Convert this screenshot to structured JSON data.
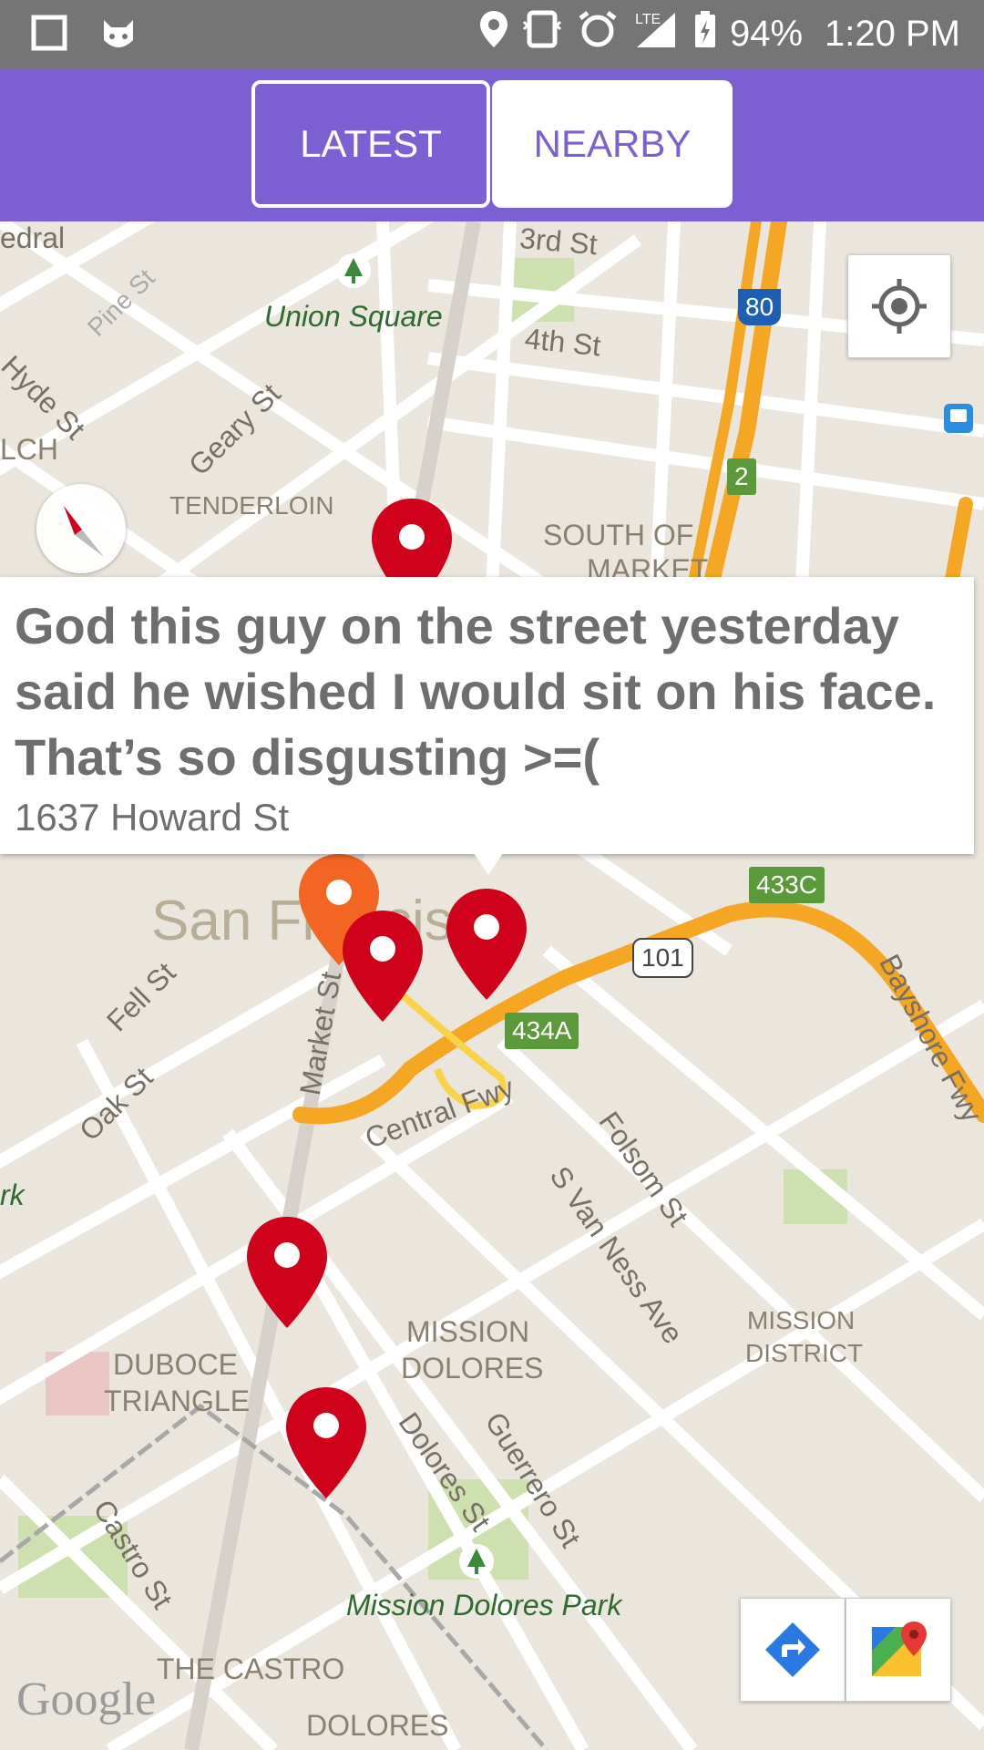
{
  "status_bar": {
    "battery": "94%",
    "time": "1:20 PM",
    "network": "LTE"
  },
  "tabs": {
    "latest": "LATEST",
    "nearby": "NEARBY"
  },
  "map": {
    "labels": {
      "cathedral": "edral",
      "union_square": "Union Square",
      "third_st": "3rd St",
      "fourth_st": "4th St",
      "pine_st": "Pine St",
      "hyde_st": "Hyde St",
      "geary_st": "Geary St",
      "lch": "LCH",
      "tenderloin": "TENDERLOIN",
      "south_of_market": "SOUTH OF",
      "south_of_market_2": "MARKET",
      "san_francisco": "San Francisco",
      "fell_st": "Fell St",
      "oak_st": "Oak St",
      "market_st": "Market St",
      "central_fwy": "Central Fwy",
      "folsom_st": "Folsom St",
      "s_van_ness": "S Van Ness Ave",
      "bayshore": "Bayshore Fwy",
      "mission_dolores": "MISSION",
      "mission_dolores_2": "DOLORES",
      "mission_district": "MISSION",
      "mission_district_2": "DISTRICT",
      "duboce": "DUBOCE",
      "duboce_2": "TRIANGLE",
      "dolores_st": "Dolores St",
      "guerrero_st": "Guerrero St",
      "castro_st": "Castro St",
      "mission_dolores_park": "Mission Dolores Park",
      "the_castro": "THE CASTRO",
      "dolores_bottom": "DOLORES",
      "rk": "rk",
      "google": "Google"
    },
    "shields": {
      "i80": "80",
      "r2": "2",
      "exit_433c": "433C",
      "us101": "101",
      "exit_434a": "434A"
    }
  },
  "popup": {
    "message": "God this guy on the street yesterday said he wished I would sit on his face. That’s so disgusting >=(",
    "address": "1637 Howard St"
  },
  "colors": {
    "header": "#7b5fd3",
    "pin_red": "#d0021b",
    "pin_orange": "#f26522",
    "freeway": "#f5a623"
  }
}
